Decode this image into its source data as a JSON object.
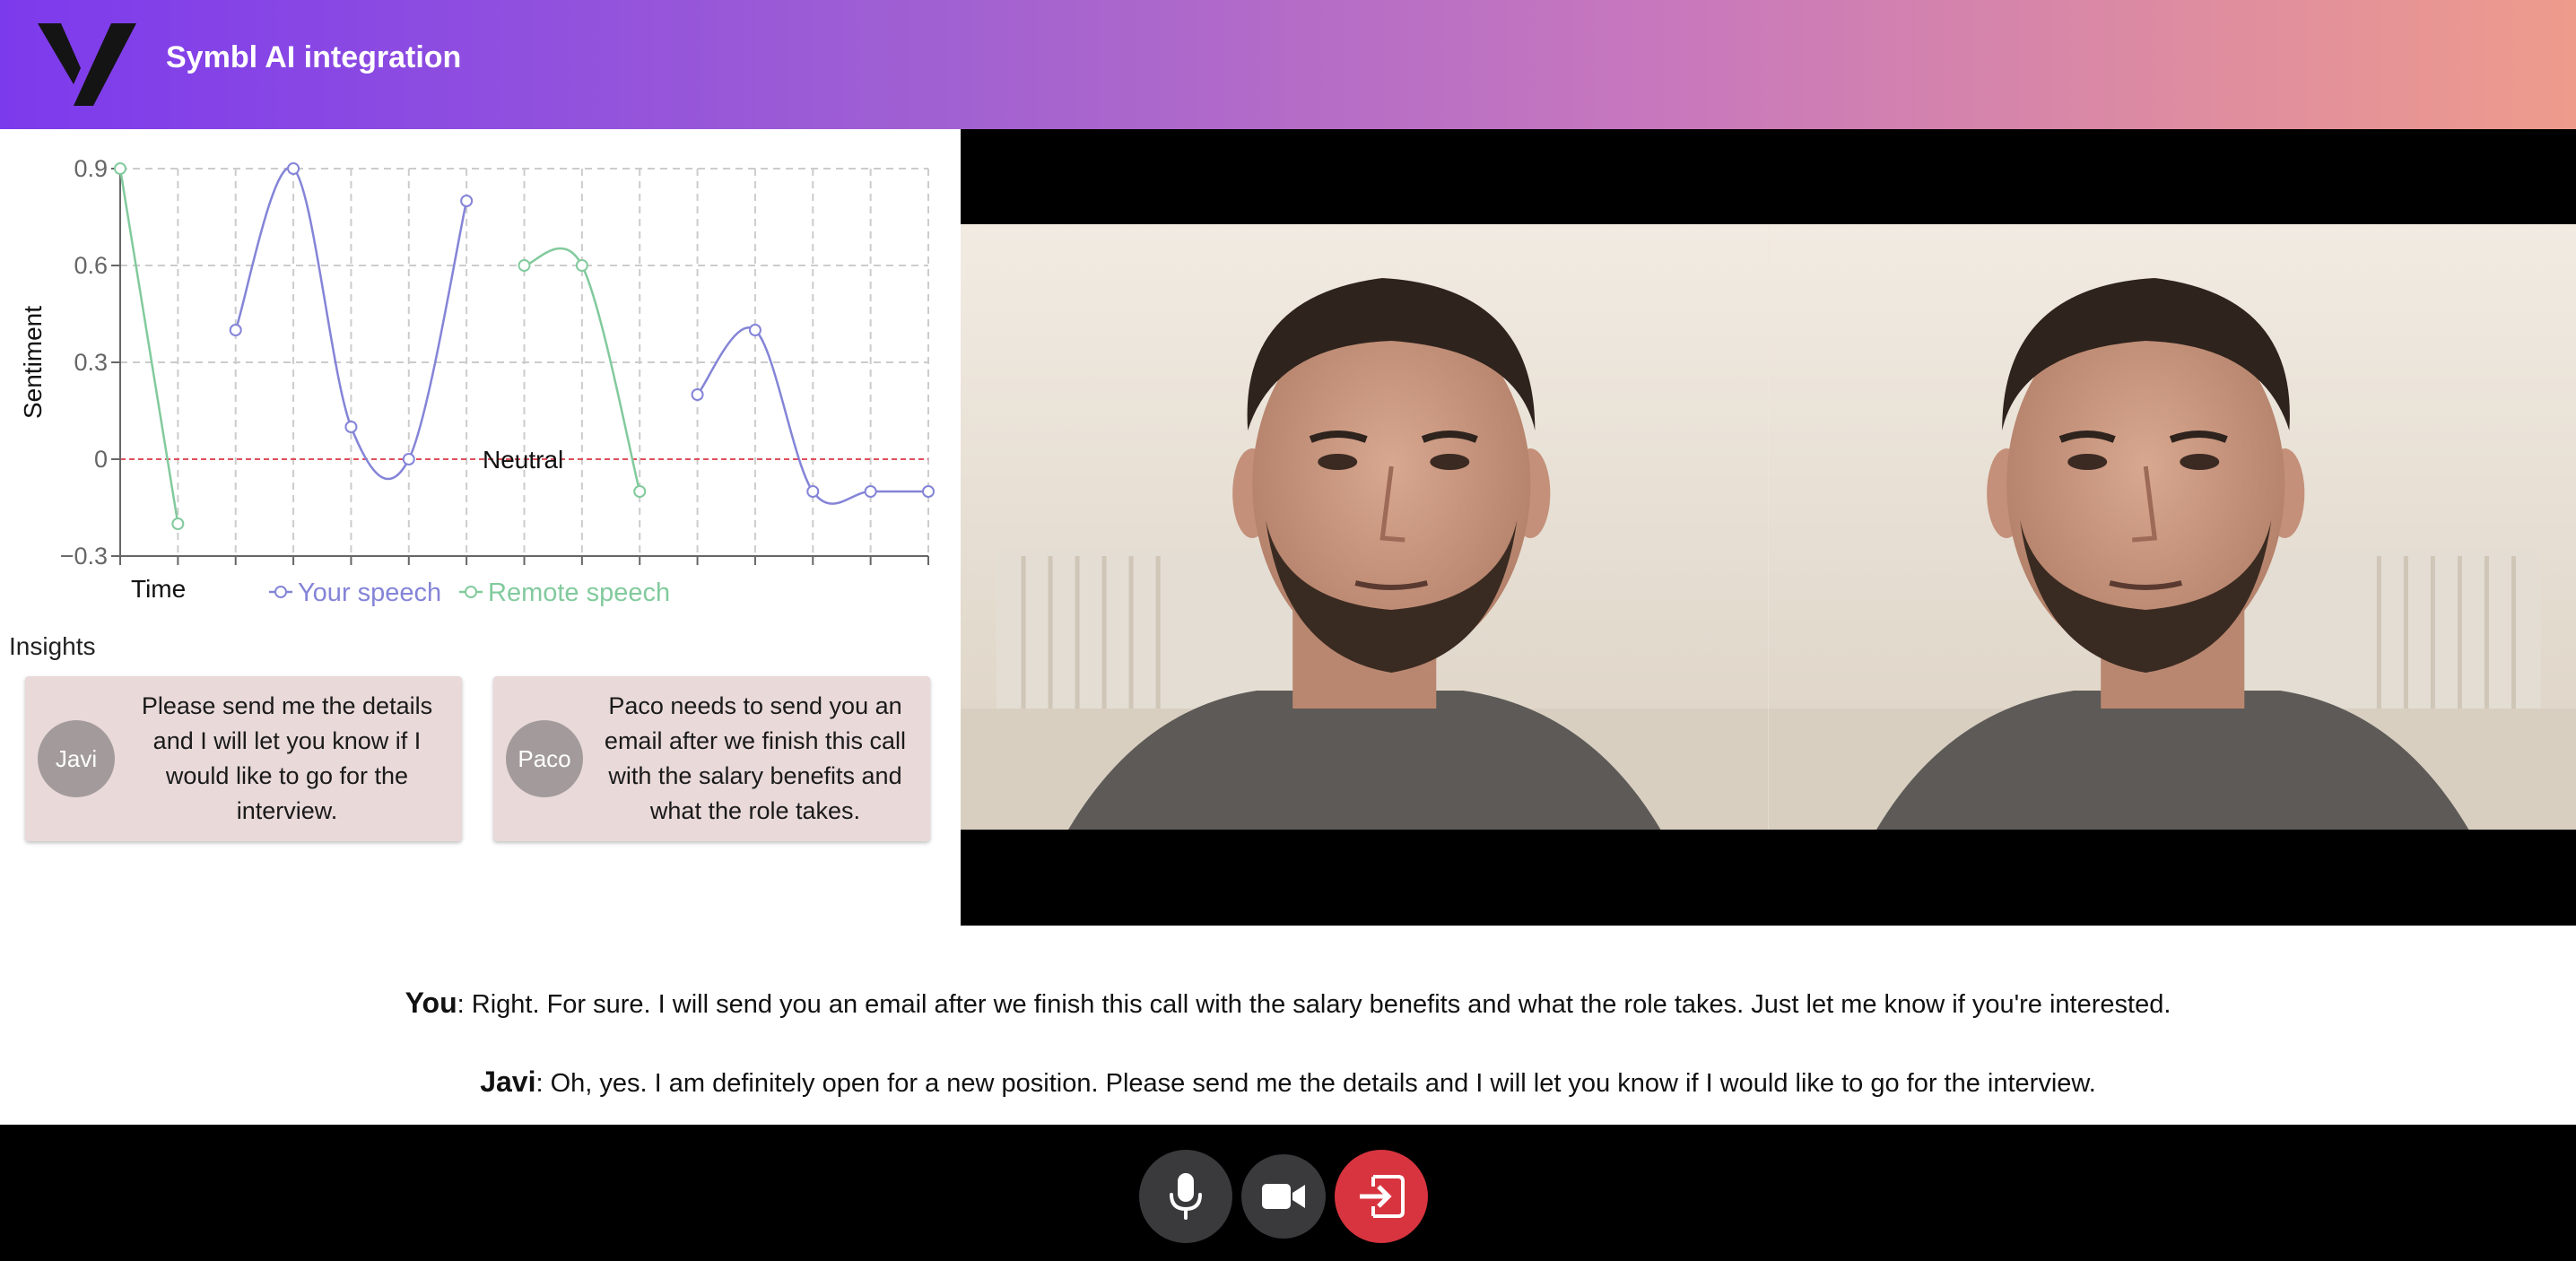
{
  "header": {
    "title": "Symbl AI integration"
  },
  "chart_data": {
    "type": "line",
    "ylabel": "Sentiment",
    "xlabel": "Time",
    "ylim": [
      -0.3,
      0.9
    ],
    "yticks": [
      "0.9",
      "0.6",
      "0.3",
      "0",
      "−0.3"
    ],
    "x_count": 14,
    "neutral_label": "Neutral",
    "neutral_value": 0,
    "grid": true,
    "legend_position": "bottom",
    "series": [
      {
        "name": "Your speech",
        "color": "#8484d8",
        "values": [
          null,
          null,
          0.4,
          0.9,
          0.1,
          0.0,
          0.8,
          null,
          null,
          null,
          0.2,
          0.4,
          -0.1,
          -0.1,
          -0.1
        ]
      },
      {
        "name": "Remote speech",
        "color": "#82ca9d",
        "values": [
          0.9,
          -0.2,
          null,
          null,
          null,
          null,
          null,
          0.6,
          0.6,
          -0.1,
          null,
          null,
          null,
          null,
          null
        ]
      }
    ]
  },
  "insights": {
    "title": "Insights",
    "cards": [
      {
        "avatar": "Javi",
        "text": "Please send me the details and I will let you know if I would like to go for the interview."
      },
      {
        "avatar": "Paco",
        "text": "Paco needs to send you an email after we finish this call with the salary benefits and what the role takes."
      }
    ]
  },
  "transcript": [
    {
      "speaker": "You",
      "text": ": Right. For sure. I will send you an email after we finish this call with the salary benefits and what the role takes. Just let me know if you're interested."
    },
    {
      "speaker": "Javi",
      "text": ": Oh, yes. I am definitely open for a new position. Please send me the details and I will let you know if I would like to go for the interview."
    }
  ],
  "controls": {
    "mic_icon": "microphone-icon",
    "camera_icon": "video-camera-icon",
    "leave_icon": "leave-call-icon",
    "leave_color": "#d8343f"
  }
}
